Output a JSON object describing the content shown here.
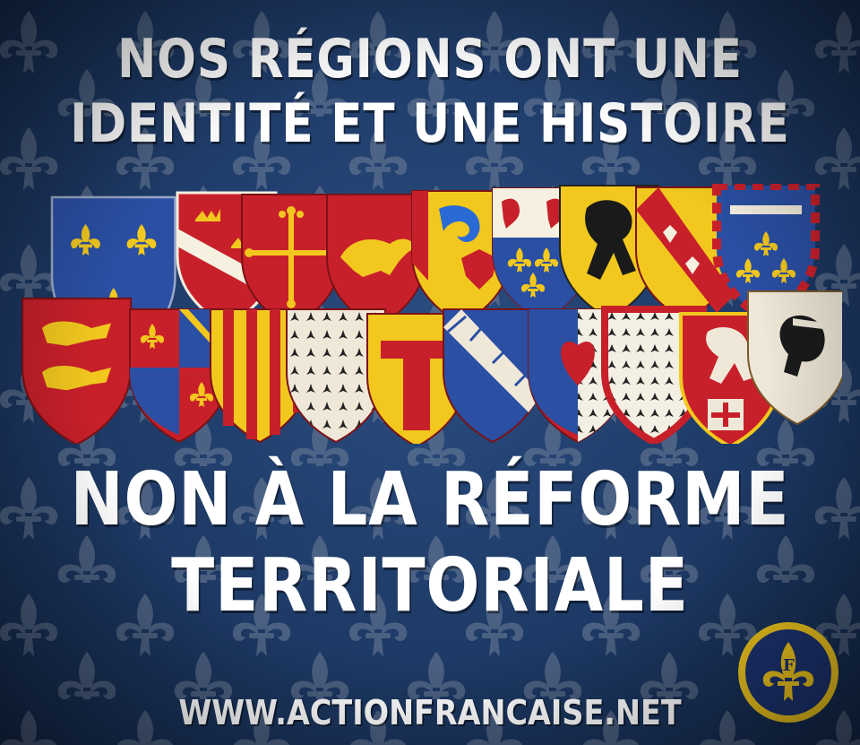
{
  "headline_top": {
    "line1": "NOS RÉGIONS ONT UNE",
    "line2": "IDENTITÉ ET UNE HISTOIRE"
  },
  "headline_bottom": {
    "line1": "NON À LA RÉFORME",
    "line2": "TERRITORIALE"
  },
  "website": "WWW.ACTIONFRANCAISE.NET",
  "logo": {
    "icon": "fleur-de-lis-af-icon",
    "letters": "AF"
  },
  "colors": {
    "background": "#1e3a66",
    "fleur_pattern": "#6e7f99",
    "text": "#ffffff",
    "shield_red": "#c8202a",
    "shield_gold": "#f2c81e",
    "shield_blue": "#2a4fa3",
    "logo_ring": "#f2c81e",
    "logo_inner": "#1d3472"
  },
  "shields": [
    {
      "name": "ile-de-france-shield",
      "field": "#2a4fa3",
      "charge": "fleur-de-lis"
    },
    {
      "name": "alsace-shield",
      "field": "#c8202a",
      "charge": "crowns-bend"
    },
    {
      "name": "occitanie-shield",
      "field": "#c8202a",
      "charge": "occitan-cross"
    },
    {
      "name": "limousin-shield",
      "field": "#c8202a",
      "charge": "lion"
    },
    {
      "name": "provence-shield",
      "field": "#f2c81e",
      "charge": "dolphin-eagle"
    },
    {
      "name": "picardie-shield",
      "field": "#f2c81e",
      "charge": "lions-fleurs"
    },
    {
      "name": "nord-pas-de-calais-shield",
      "field": "#f2c81e",
      "charge": "black-lion"
    },
    {
      "name": "lorraine-shield",
      "field": "#f2c81e",
      "charge": "red-bend-alerions"
    },
    {
      "name": "centre-shield",
      "field": "#2a4fa3",
      "charge": "fleurs-bordure"
    },
    {
      "name": "normandie-shield",
      "field": "#c8202a",
      "charge": "two-leopards"
    },
    {
      "name": "bourgogne-shield",
      "field": "#c8202a",
      "charge": "quartered"
    },
    {
      "name": "languedoc-roussillon-shield",
      "field": "#f2c81e",
      "charge": "red-pales"
    },
    {
      "name": "bretagne-shield",
      "field": "#efe8d8",
      "charge": "ermine"
    },
    {
      "name": "midi-pyrenees-shield",
      "field": "#f2c81e",
      "charge": "red-tau"
    },
    {
      "name": "champagne-shield",
      "field": "#2a4fa3",
      "charge": "white-bend"
    },
    {
      "name": "pays-de-la-loire-shield",
      "field": "#c8202a",
      "charge": "ermine-heart"
    },
    {
      "name": "poitou-shield",
      "field": "#c8202a",
      "charge": "ermine-bordure"
    },
    {
      "name": "rhone-alpes-shield",
      "field": "#c8202a",
      "charge": "lion-cross"
    },
    {
      "name": "corse-shield",
      "field": "#efe8d8",
      "charge": "moor-head"
    }
  ]
}
